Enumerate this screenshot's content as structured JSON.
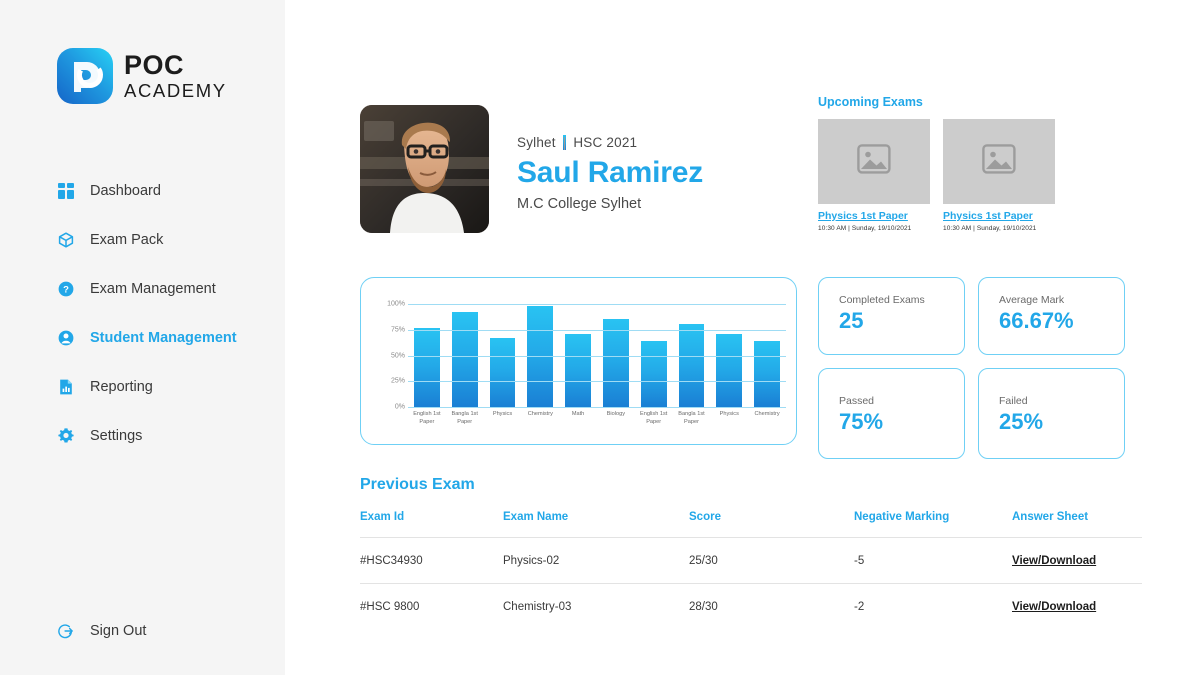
{
  "brand": {
    "name_top": "POC",
    "name_bottom": "ACADEMY",
    "logo_icon": "poc-logo-icon",
    "accent": "#22a7e8"
  },
  "sidebar": {
    "items": [
      {
        "label": "Dashboard",
        "icon": "grid-dashboard-icon",
        "active": false
      },
      {
        "label": "Exam Pack",
        "icon": "cube-package-icon",
        "active": false
      },
      {
        "label": "Exam Management",
        "icon": "question-circle-icon",
        "active": false
      },
      {
        "label": "Student Management",
        "icon": "user-circle-icon",
        "active": true
      },
      {
        "label": "Reporting",
        "icon": "bar-chart-document-icon",
        "active": false
      },
      {
        "label": "Settings",
        "icon": "gear-icon",
        "active": false
      }
    ],
    "signout": {
      "label": "Sign Out",
      "icon": "sign-out-circle-arrow-icon"
    }
  },
  "profile": {
    "avatar_icon": "student-photo",
    "meta_location": "Sylhet",
    "meta_separator": "|",
    "meta_session": "HSC 2021",
    "name": "Saul Ramirez",
    "college": "M.C College Sylhet"
  },
  "upcoming": {
    "title": "Upcoming Exams",
    "cards": [
      {
        "thumb_icon": "image-placeholder-icon",
        "name": "Physics 1st Paper",
        "time": "10:30 AM | Sunday, 19/10/2021"
      },
      {
        "thumb_icon": "image-placeholder-icon",
        "name": "Physics 1st Paper",
        "time": "10:30 AM | Sunday, 19/10/2021"
      }
    ]
  },
  "chart_data": {
    "type": "bar",
    "title": "",
    "xlabel": "",
    "ylabel": "",
    "ylim": [
      0,
      100
    ],
    "ytick_labels": [
      "100%",
      "75%",
      "50%",
      "25%",
      "0%"
    ],
    "yticks": [
      100,
      75,
      50,
      25,
      0
    ],
    "grid": true,
    "legend": "none",
    "categories": [
      "English 1st Paper",
      "Bangla 1st Paper",
      "Physics",
      "Chemistry",
      "Math",
      "Biology",
      "English 1st Paper",
      "Bangla 1st Paper",
      "Physics",
      "Chemistry"
    ],
    "values": [
      77,
      92,
      67,
      98,
      71,
      85,
      64,
      81,
      71,
      64
    ]
  },
  "stats": [
    {
      "label": "Completed Exams",
      "value": "25"
    },
    {
      "label": "Average Mark",
      "value": "66.67%"
    },
    {
      "label": "Passed",
      "value": "75%"
    },
    {
      "label": "Failed",
      "value": "25%"
    }
  ],
  "previous_exam": {
    "title": "Previous Exam",
    "columns": [
      "Exam Id",
      "Exam Name",
      "Score",
      "Negative Marking",
      "Answer Sheet"
    ],
    "rows": [
      {
        "exam_id": "#HSC34930",
        "exam_name": "Physics-02",
        "score": "25/30",
        "negative_marking": "-5",
        "answer_sheet": "View/Download"
      },
      {
        "exam_id": "#HSC 9800",
        "exam_name": "Chemistry-03",
        "score": "28/30",
        "negative_marking": "-2",
        "answer_sheet": "View/Download"
      }
    ]
  }
}
